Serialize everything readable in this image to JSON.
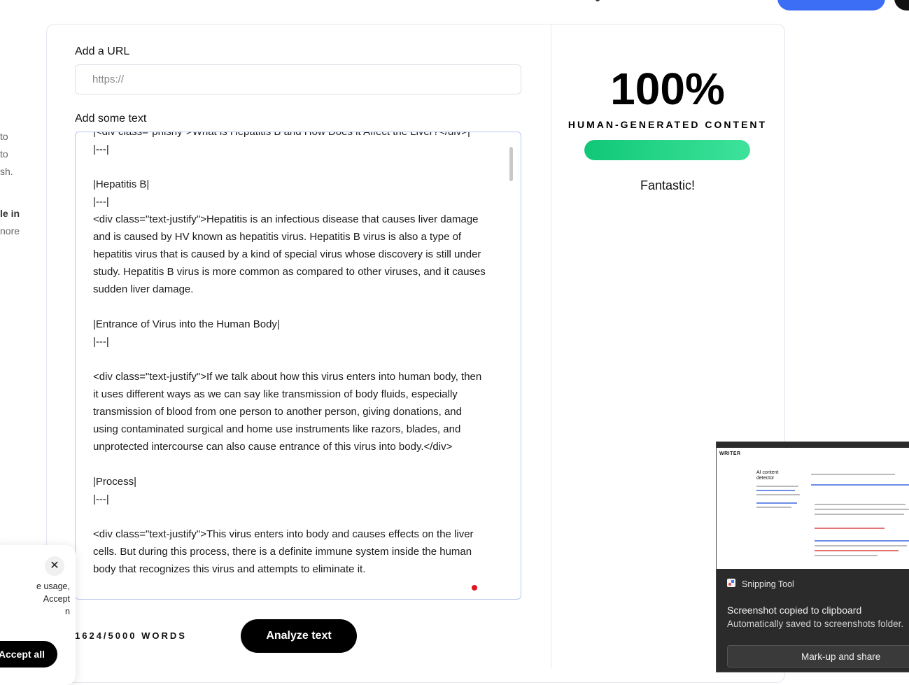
{
  "form": {
    "url_label": "Add a URL",
    "url_placeholder": "https://",
    "text_label": "Add some text",
    "text_content": "|<div class=\"phlshy\">What is Hepatitis B and How Does it Affect the Liver?</div>|\n|---|\n\n|Hepatitis B|\n|---|\n<div class=\"text-justify\">Hepatitis is an infectious disease that causes liver damage and is caused by HV known as hepatitis virus. Hepatitis B virus is also a type of hepatitis virus that is caused by a kind of special virus whose discovery is still under study. Hepatitis B virus is more common as compared to other viruses, and it causes sudden liver damage.\n\n|Entrance of Virus into the Human Body|\n|---|\n\n<div class=\"text-justify\">If we talk about how this virus enters into human body, then it uses different ways as we can say like transmission of body fluids, especially transmission of blood from one person to another person, giving donations, and using contaminated surgical and home use instruments like razors, blades, and unprotected intercourse can also cause entrance of this virus into body.</div>\n\n|Process|\n|---|\n\n<div class=\"text-justify\">This virus enters into body and causes effects on the liver cells. But during this process, there is a definite immune system inside the human body that recognizes this virus and attempts to eliminate it.",
    "word_count": "1624/5000 WORDS",
    "analyze_label": "Analyze text"
  },
  "result": {
    "score": "100%",
    "score_label": "HUMAN-GENERATED CONTENT",
    "human_fraction": 1.0,
    "verdict": "Fantastic!",
    "accent": "#10c877"
  },
  "sidebar_fragments": [
    "to",
    "to",
    "sh.",
    "le in",
    "nore"
  ],
  "cookie": {
    "text": "e usage,\nAccept\nn",
    "accept_label": "Accept all",
    "close_icon": "close-icon"
  },
  "notification": {
    "app": "Snipping Tool",
    "title": "Screenshot copied to clipboard",
    "subtitle": "Automatically saved to screenshots folder.",
    "button": "Mark-up and share",
    "thumb_logo": "WRITER",
    "thumb_title": "AI content detector"
  }
}
